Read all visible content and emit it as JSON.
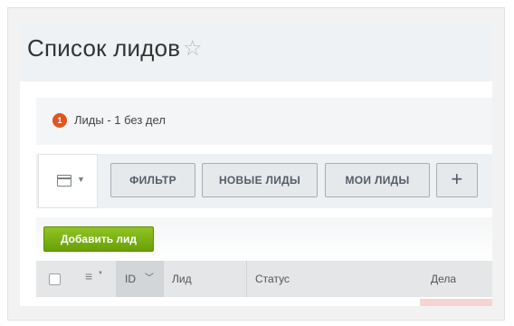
{
  "header": {
    "title": "Список лидов",
    "star_glyph": "☆"
  },
  "notice": {
    "badge_count": "1",
    "text": "Лиды - 1 без дел",
    "badge_color": "#e3531d"
  },
  "toolbar": {
    "filter_label": "ФИЛЬТР",
    "new_leads_label": "НОВЫЕ ЛИДЫ",
    "my_leads_label": "МОИ ЛИДЫ",
    "add_filter_label": "+"
  },
  "actions": {
    "add_lead_label": "Добавить лид",
    "accent": "#7cb313"
  },
  "table": {
    "columns": {
      "id": "ID",
      "lead": "Лид",
      "status": "Статус",
      "deals": "Дела"
    }
  }
}
